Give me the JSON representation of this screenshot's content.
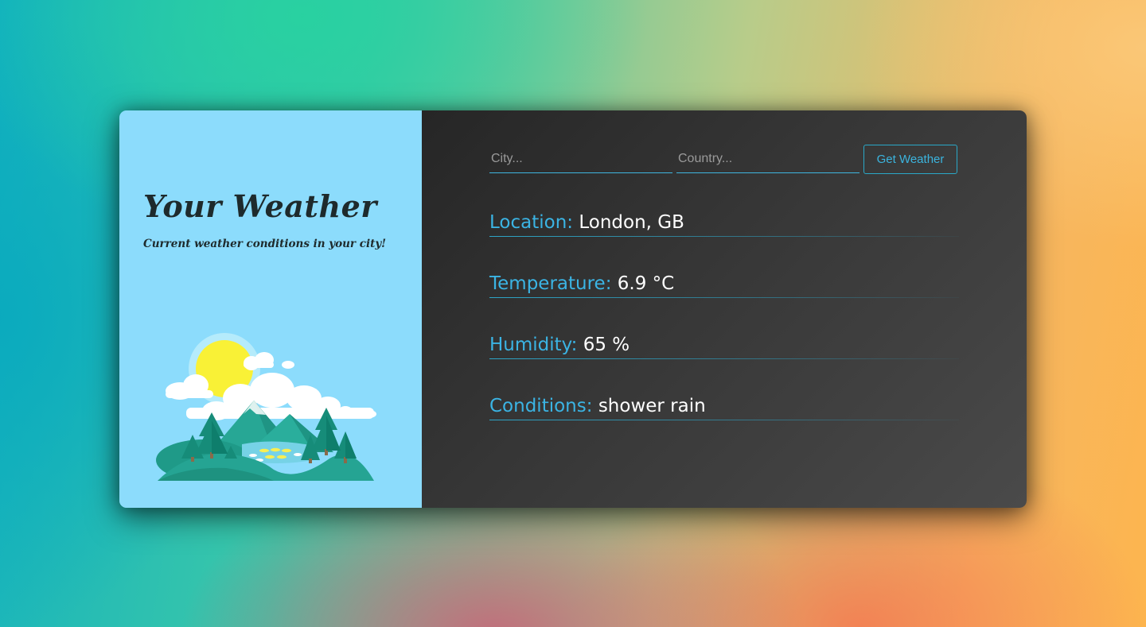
{
  "header": {
    "title": "Your Weather",
    "subtitle": "Current weather conditions in your city!"
  },
  "form": {
    "city_placeholder": "City...",
    "country_placeholder": "Country...",
    "city_value": "",
    "country_value": "",
    "submit_label": "Get Weather"
  },
  "weather": {
    "location": {
      "label": "Location:",
      "value": "London, GB"
    },
    "temperature": {
      "label": "Temperature:",
      "value": "6.9 °C"
    },
    "humidity": {
      "label": "Humidity:",
      "value": "65 %"
    },
    "conditions": {
      "label": "Conditions:",
      "value": "shower rain"
    }
  },
  "icons": {
    "illustration": "landscape-illustration"
  },
  "colors": {
    "accent": "#3bb4e4",
    "left_panel": "#8cdcfc",
    "right_panel": "#353535",
    "title_text": "#1e2a2c"
  }
}
